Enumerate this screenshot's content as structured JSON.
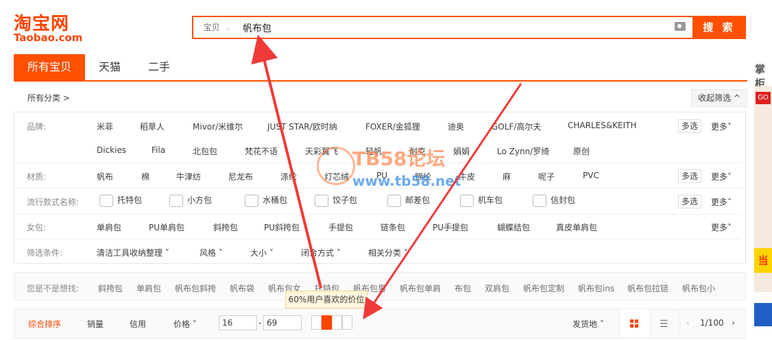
{
  "logo": {
    "cn": "淘宝网",
    "en": "Taobao.com"
  },
  "search": {
    "category": "宝贝",
    "value": "帆布包",
    "button": "搜 索"
  },
  "tabs": [
    "所有宝贝",
    "天猫",
    "二手"
  ],
  "side_label": "掌柜",
  "breadcrumb": "所有分类 >",
  "collapse": "收起筛选 ^",
  "filters": {
    "brand": {
      "label": "品牌:",
      "row1": [
        "米菲",
        "稻草人",
        "Mivor/米维尔",
        "JUST STAR/欧时纳",
        "FOXER/金狐狸",
        "迪奥",
        "GOLF/高尔夫",
        "CHARLES&KEITH"
      ],
      "row2": [
        "Dickies",
        "Fila",
        "北包包",
        "梵花不语",
        "天彩翼飞",
        "轻帆",
        "耐克",
        "娟娟",
        "Lo Zynn/罗绮",
        "原创"
      ]
    },
    "material": {
      "label": "材质:",
      "items": [
        "帆布",
        "棉",
        "牛津纺",
        "尼龙布",
        "涤纶",
        "灯芯绒",
        "PU",
        "锦纶",
        "牛皮",
        "麻",
        "呢子",
        "PVC"
      ]
    },
    "style": {
      "label": "流行款式名称:",
      "items": [
        "托特包",
        "小方包",
        "水桶包",
        "饺子包",
        "邮差包",
        "机车包",
        "信封包"
      ]
    },
    "women": {
      "label": "女包:",
      "items": [
        "单肩包",
        "PU单肩包",
        "斜挎包",
        "PU斜挎包",
        "手提包",
        "链条包",
        "PU手提包",
        "蝴蝶结包",
        "真皮单肩包"
      ]
    },
    "conditions": {
      "label": "筛选条件:",
      "items": [
        "清洁工具收纳整理",
        "风格",
        "大小",
        "闭合方式",
        "相关分类"
      ]
    },
    "multi": "多选",
    "more": "更多"
  },
  "suggest": {
    "label": "您是不是想找:",
    "items": [
      "斜挎包",
      "单肩包",
      "帆布包斜挎",
      "帆布袋",
      "帆布包女",
      "托特包",
      "帆布包男",
      "帆布包单肩",
      "布包",
      "双肩包",
      "帆布包定制",
      "帆布包ins",
      "帆布包拉链",
      "帆布包小"
    ]
  },
  "sort": {
    "items": [
      "综合排序",
      "销量",
      "信用",
      "价格"
    ],
    "price_low": "16",
    "price_high": "69",
    "price_sep": "-",
    "tooltip": "60%用户喜欢的价位",
    "ship": "发货地",
    "page": "1/100"
  },
  "watermark": {
    "t1": "TB58论坛",
    "t2": "www.tb58.net"
  },
  "ad": {
    "tag": "GO",
    "yellow": "当"
  },
  "colors": {
    "accent": "#ff5000",
    "arrow": "#f03a3a"
  }
}
